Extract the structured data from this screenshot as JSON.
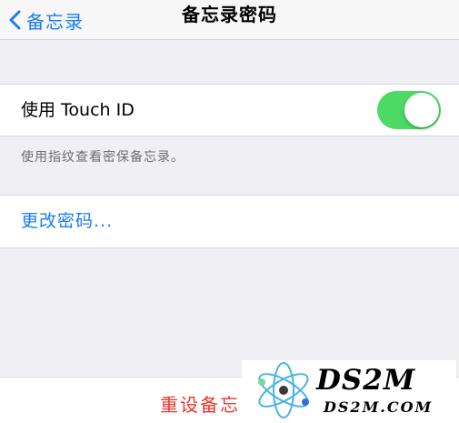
{
  "nav": {
    "back_label": "备忘录",
    "title": "备忘录密码"
  },
  "touch_id": {
    "label": "使用 Touch ID",
    "enabled": true,
    "footnote": "使用指纹查看密保备忘录。"
  },
  "change_password": {
    "label": "更改密码..."
  },
  "reset": {
    "label": "重设备忘"
  },
  "watermark": {
    "brand": "DS2M",
    "domain": "DS2M.COM"
  },
  "colors": {
    "accent": "#1a7cf6",
    "toggle_on": "#4cd964",
    "destructive": "#e8372d",
    "background": "#efeff4"
  }
}
